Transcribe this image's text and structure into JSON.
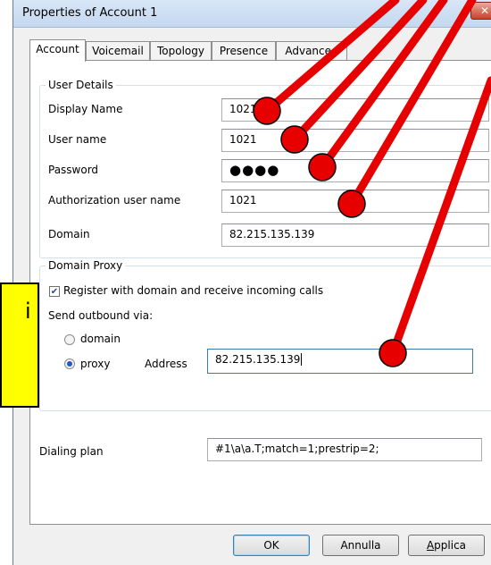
{
  "window": {
    "title": "Properties of Account 1",
    "close_glyph": "✕"
  },
  "tabs": [
    {
      "label": "Account"
    },
    {
      "label": "Voicemail"
    },
    {
      "label": "Topology"
    },
    {
      "label": "Presence"
    },
    {
      "label": "Advanced"
    }
  ],
  "user_details": {
    "legend": "User Details",
    "display_name_label": "Display Name",
    "display_name_value": "1021",
    "user_name_label": "User name",
    "user_name_value": "1021",
    "password_label": "Password",
    "password_value": "●●●●",
    "auth_user_label": "Authorization user name",
    "auth_user_value": "1021",
    "domain_label": "Domain",
    "domain_value": "82.215.135.139"
  },
  "domain_proxy": {
    "legend": "Domain Proxy",
    "register_label": "Register with domain and receive incoming calls",
    "register_checked": true,
    "send_outbound_label": "Send outbound via:",
    "option_domain": "domain",
    "option_proxy": "proxy",
    "selected": "proxy",
    "address_label": "Address",
    "address_value": "82.215.135.139"
  },
  "dialing_plan": {
    "label": "Dialing plan",
    "value": "#1\\a\\a.T;match=1;prestrip=2;"
  },
  "buttons": {
    "ok": "OK",
    "cancel": "Annulla",
    "apply": "Applica"
  },
  "annotation": {
    "text": "i",
    "box_color": "#ffff00",
    "marker_color": "#e60000"
  }
}
